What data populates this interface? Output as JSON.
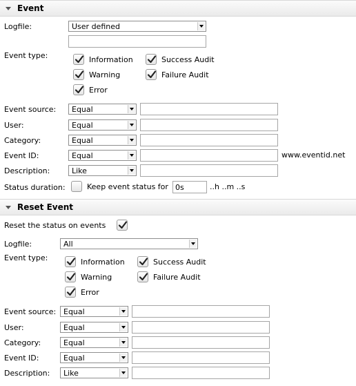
{
  "event": {
    "title": "Event",
    "logfile_label": "Logfile:",
    "logfile_value": "User defined",
    "logfile_custom_value": "",
    "event_type_label": "Event type:",
    "types": [
      {
        "label": "Information",
        "checked": true
      },
      {
        "label": "Success Audit",
        "checked": true
      },
      {
        "label": "Warning",
        "checked": true
      },
      {
        "label": "Failure Audit",
        "checked": true
      },
      {
        "label": "Error",
        "checked": true
      }
    ],
    "filters": [
      {
        "label": "Event source:",
        "operator": "Equal",
        "value": ""
      },
      {
        "label": "User:",
        "operator": "Equal",
        "value": ""
      },
      {
        "label": "Category:",
        "operator": "Equal",
        "value": ""
      },
      {
        "label": "Event ID:",
        "operator": "Equal",
        "value": ""
      },
      {
        "label": "Description:",
        "operator": "Like",
        "value": ""
      }
    ],
    "event_id_link": "www.eventid.net",
    "status_duration_label": "Status duration:",
    "status_duration_checked": false,
    "keep_status_label": "Keep event status for",
    "keep_status_value": "0s",
    "keep_status_hint": "..h ..m ..s"
  },
  "reset_event": {
    "title": "Reset Event",
    "reset_label": "Reset the status on events",
    "reset_checked": true,
    "logfile_label": "Logfile:",
    "logfile_value": "All",
    "event_type_label": "Event type:",
    "types": [
      {
        "label": "Information",
        "checked": true
      },
      {
        "label": "Success Audit",
        "checked": true
      },
      {
        "label": "Warning",
        "checked": true
      },
      {
        "label": "Failure Audit",
        "checked": true
      },
      {
        "label": "Error",
        "checked": true
      }
    ],
    "filters": [
      {
        "label": "Event source:",
        "operator": "Equal",
        "value": ""
      },
      {
        "label": "User:",
        "operator": "Equal",
        "value": ""
      },
      {
        "label": "Category:",
        "operator": "Equal",
        "value": ""
      },
      {
        "label": "Event ID:",
        "operator": "Equal",
        "value": ""
      },
      {
        "label": "Description:",
        "operator": "Like",
        "value": ""
      }
    ]
  }
}
